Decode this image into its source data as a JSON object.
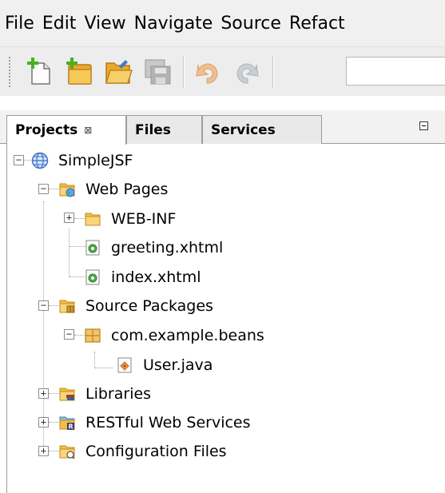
{
  "menu": [
    "File",
    "Edit",
    "View",
    "Navigate",
    "Source",
    "Refact"
  ],
  "toolbar": {
    "buttons": [
      "new-file-icon",
      "new-project-icon",
      "open-project-icon",
      "save-all-icon",
      "undo-icon",
      "redo-icon"
    ]
  },
  "tabs": {
    "projects": "Projects",
    "files": "Files",
    "services": "Services"
  },
  "tree": {
    "root": "SimpleJSF",
    "web_pages": "Web Pages",
    "web_inf": "WEB-INF",
    "greeting": "greeting.xhtml",
    "index": "index.xhtml",
    "source_packages": "Source Packages",
    "package": "com.example.beans",
    "user_java": "User.java",
    "libraries": "Libraries",
    "restful": "RESTful Web Services",
    "config": "Configuration Files"
  },
  "colors": {
    "folder": "#e8b23a",
    "xhtml": "#3b8a3a",
    "globe": "#3a6fc4"
  }
}
